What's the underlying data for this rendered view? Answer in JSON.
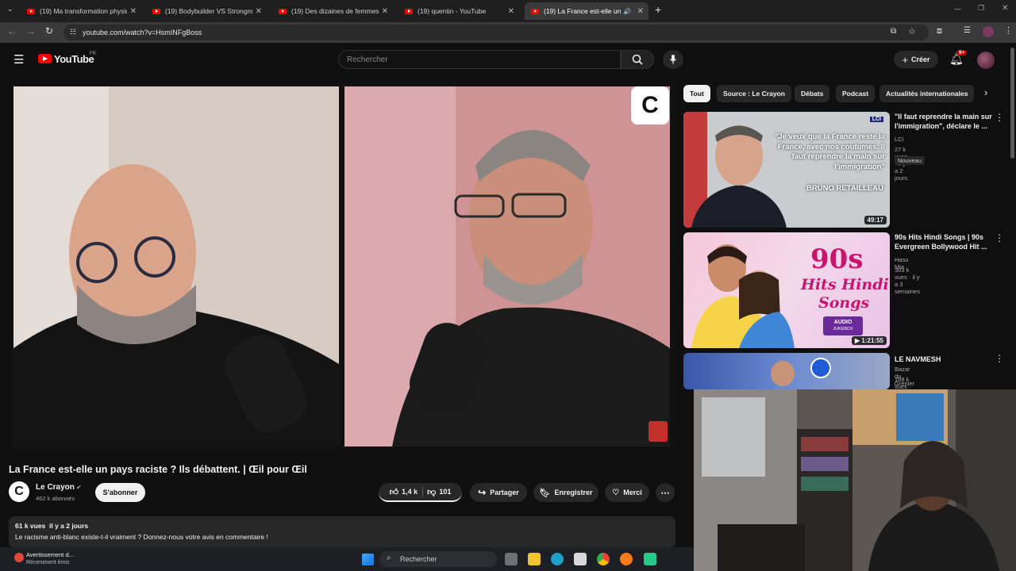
{
  "browser": {
    "tabs": [
      {
        "label": "(19) Ma transformation physiq"
      },
      {
        "label": "(19) Bodybuilder VS Strongman"
      },
      {
        "label": "(19) Des dizaines de femmes vo"
      },
      {
        "label": "(19) quentin - YouTube"
      },
      {
        "label": "(19) La France est-elle un pa"
      }
    ],
    "url": "youtube.com/watch?v=HsmINFgBoss"
  },
  "yt": {
    "logo_text": "YouTube",
    "region": "FR",
    "search_placeholder": "Rechercher",
    "create_label": "Créer",
    "notif_badge": "9+"
  },
  "video": {
    "title": "La France est-elle un pays raciste ? Ils débattent. | Œil pour Œil",
    "channel": "Le Crayon",
    "subscribers": "462 k abonnés",
    "subscribe_label": "S'abonner",
    "likes": "1,4 k",
    "dislikes": "101",
    "share_label": "Partager",
    "save_label": "Enregistrer",
    "thanks_label": "Merci",
    "views_date": "61 k vues  il y a 2 jours",
    "description": "Le racisme anti-blanc existe-t-il vraiment ? Donnez-nous votre avis en commentaire !"
  },
  "chips": [
    "Tout",
    "Source : Le Crayon",
    "Débats",
    "Podcast",
    "Actualités internationales"
  ],
  "recs": [
    {
      "title": "\"Il faut reprendre la main sur l'immigration\", déclare le ...",
      "channel": "LCI",
      "meta": "27 k vues · il y a 2 jours",
      "badge": "Nouveau",
      "duration": "49:17",
      "thumb_text": "\"Je veux que la France reste la France, avec nos coutumes. Il faut reprendre la main sur l'immigration\"",
      "thumb_name": "BRUNO RETAILLEAU",
      "thumb_logo": "LCI"
    },
    {
      "title": "90s Hits Hindi Songs | 90s Evergreen Bollywood Hit ...",
      "channel": "Hasu Mia",
      "meta": "303 k vues · il y a 3 semaines",
      "duration": "1:21:55",
      "thumb_big": "90s",
      "thumb_sub1": "Hits Hindi",
      "thumb_sub2": "Songs",
      "thumb_badge1": "AUDIO",
      "thumb_badge2": "JUKEBOX"
    },
    {
      "title": "LE NAVMESH",
      "channel": "Bazar du Grenier",
      "meta": "168 k vues · il y a 6 heures"
    }
  ],
  "taskbar": {
    "notif_title": "Avertissement d...",
    "notif_sub": "Récemment émis",
    "search_label": "Rechercher"
  },
  "colors": {
    "youtube_red": "#ff0000",
    "bg": "#0f0f0f",
    "chip": "#272727"
  }
}
